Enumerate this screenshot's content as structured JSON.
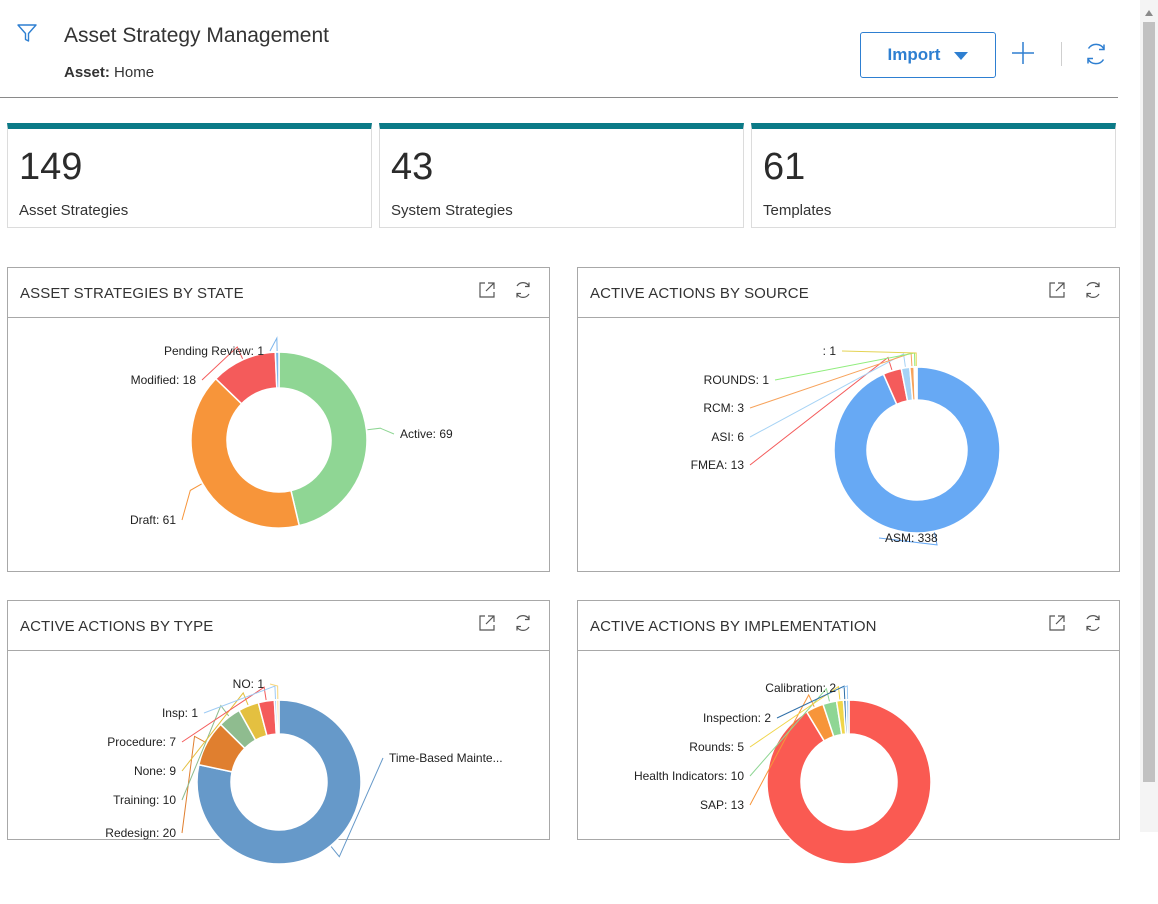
{
  "header": {
    "title": "Asset Strategy Management",
    "breadcrumb_label": "Asset:",
    "breadcrumb_value": "Home",
    "import_label": "Import"
  },
  "kpis": [
    {
      "value": "149",
      "label": "Asset Strategies"
    },
    {
      "value": "43",
      "label": "System Strategies"
    },
    {
      "value": "61",
      "label": "Templates"
    }
  ],
  "cards": [
    {
      "title": "ASSET STRATEGIES BY STATE"
    },
    {
      "title": "ACTIVE ACTIONS BY SOURCE"
    },
    {
      "title": "ACTIVE ACTIONS BY TYPE"
    },
    {
      "title": "ACTIVE ACTIONS BY IMPLEMENTATION"
    }
  ],
  "chart_data": [
    {
      "type": "pie",
      "title": "ASSET STRATEGIES BY STATE",
      "donut": true,
      "slices": [
        {
          "label": "Active",
          "value": 69,
          "color": "#8fd694"
        },
        {
          "label": "Draft",
          "value": 61,
          "color": "#f7953a"
        },
        {
          "label": "Modified",
          "value": 18,
          "color": "#f45b5b"
        },
        {
          "label": "Pending Review",
          "value": 1,
          "color": "#7cb5ec"
        }
      ],
      "slice_labels": [
        "Active: 69",
        "Draft: 61",
        "Modified: 18",
        "Pending Review: 1"
      ]
    },
    {
      "type": "pie",
      "title": "ACTIVE ACTIONS BY SOURCE",
      "donut": true,
      "slices": [
        {
          "label": "ASM",
          "value": 338,
          "color": "#67a9f4"
        },
        {
          "label": "FMEA",
          "value": 13,
          "color": "#f45b5b"
        },
        {
          "label": "ASI",
          "value": 6,
          "color": "#a6d3f5"
        },
        {
          "label": "RCM",
          "value": 3,
          "color": "#f7a35c"
        },
        {
          "label": "ROUNDS",
          "value": 1,
          "color": "#90ed7d"
        },
        {
          "label": "",
          "value": 1,
          "color": "#e4d354"
        }
      ],
      "slice_labels": [
        "ASM: 338",
        "FMEA: 13",
        "ASI: 6",
        "RCM: 3",
        "ROUNDS: 1",
        ": 1"
      ]
    },
    {
      "type": "pie",
      "title": "ACTIVE ACTIONS BY TYPE",
      "donut": true,
      "slices": [
        {
          "label": "Time-Based Mainte...",
          "value": 174,
          "color": "#6699c9"
        },
        {
          "label": "Redesign",
          "value": 20,
          "color": "#e07f2f"
        },
        {
          "label": "Training",
          "value": 10,
          "color": "#8fbc8f"
        },
        {
          "label": "None",
          "value": 9,
          "color": "#e4c040"
        },
        {
          "label": "Procedure",
          "value": 7,
          "color": "#f45b5b"
        },
        {
          "label": "Insp",
          "value": 1,
          "color": "#9ecbf5"
        },
        {
          "label": "NO",
          "value": 1,
          "color": "#f7d67a"
        }
      ],
      "slice_labels": [
        "Time-Based Mainte...",
        "Redesign: 20",
        "Training: 10",
        "None: 9",
        "Procedure: 7",
        "Insp: 1",
        "NO: 1"
      ]
    },
    {
      "type": "pie",
      "title": "ACTIVE ACTIONS BY IMPLEMENTATION",
      "donut": true,
      "slices": [
        {
          "label": "",
          "value": 338,
          "color": "#fa5a52"
        },
        {
          "label": "SAP",
          "value": 13,
          "color": "#f7953a"
        },
        {
          "label": "Health Indicators",
          "value": 10,
          "color": "#8fd694"
        },
        {
          "label": "Rounds",
          "value": 5,
          "color": "#f0d54a"
        },
        {
          "label": "Inspection",
          "value": 2,
          "color": "#2f6fa8"
        },
        {
          "label": "Calibration",
          "value": 2,
          "color": "#9ecbf5"
        }
      ],
      "slice_labels": [
        "SAP: 13",
        "Health Indicators: 10",
        "Rounds: 5",
        "Inspection: 2",
        "Calibration: 2"
      ]
    }
  ]
}
